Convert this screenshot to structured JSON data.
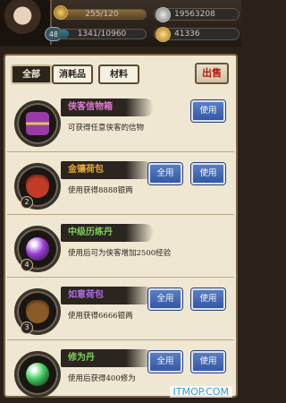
{
  "header": {
    "stamina": "255/120",
    "exp": "1341/10960",
    "level": "48",
    "silver": "19563208",
    "gold": "41336"
  },
  "tabs": [
    {
      "label": "全部"
    },
    {
      "label": "消耗品"
    },
    {
      "label": "材料"
    }
  ],
  "sell_label": "出售",
  "items": [
    {
      "name": "侠客信物箱",
      "desc": "可获得任意侠客的信物",
      "count": "",
      "name_color": "#e07ad0",
      "icon": "chest-icon",
      "icon_color": "#9a3aa8",
      "buttons": [
        "使用"
      ]
    },
    {
      "name": "金镶荷包",
      "desc": "使用获得8888银两",
      "count": "2",
      "name_color": "#e8a838",
      "icon": "pouch-icon",
      "icon_color": "#c23a28",
      "buttons": [
        "全用",
        "使用"
      ]
    },
    {
      "name": "中级历练丹",
      "desc": "使用后可为侠客增加2500经验",
      "count": "4",
      "name_color": "#7fcf5a",
      "icon": "pill-icon",
      "icon_color": "#9a3ad8",
      "buttons": []
    },
    {
      "name": "如意荷包",
      "desc": "使用获得6666银两",
      "count": "3",
      "name_color": "#b06ae0",
      "icon": "pouch-icon",
      "icon_color": "#8a5a28",
      "buttons": [
        "全用",
        "使用"
      ]
    },
    {
      "name": "修为丹",
      "desc": "使用后获得400修为",
      "count": "",
      "name_color": "#7fcf5a",
      "icon": "pill-icon",
      "icon_color": "#3ac858",
      "buttons": [
        "全用",
        "使用"
      ]
    }
  ],
  "watermark": "ITMOP.COM"
}
